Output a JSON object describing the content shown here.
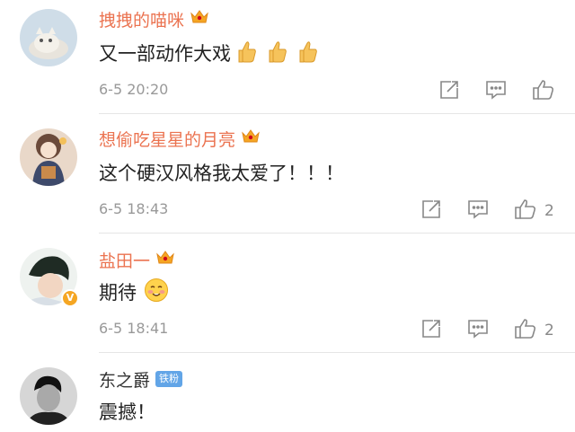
{
  "comments": [
    {
      "user": "拽拽的喵咪",
      "text": "又一部动作大戏",
      "time": "6-5 20:20",
      "likes": ""
    },
    {
      "user": "想偷吃星星的月亮",
      "text": "这个硬汉风格我太爱了！！！",
      "time": "6-5 18:43",
      "likes": "2"
    },
    {
      "user": "盐田一",
      "text": "期待",
      "time": "6-5 18:41",
      "likes": "2"
    },
    {
      "user": "东之爵",
      "badge": "铁粉",
      "text": "震撼！"
    }
  ],
  "icons": {
    "crown": "vip-crown-icon",
    "thumbs_up_emoji": "thumbs-up-emoji-icon",
    "blush_emoji": "blush-smile-emoji-icon",
    "repost": "repost-icon",
    "reply": "comment-icon",
    "like": "like-icon",
    "verified": "verified-v-icon"
  },
  "colors": {
    "username": "#eb7350",
    "username_plain": "#333333",
    "fan_badge": "#62a5e7",
    "meta": "#999999"
  }
}
